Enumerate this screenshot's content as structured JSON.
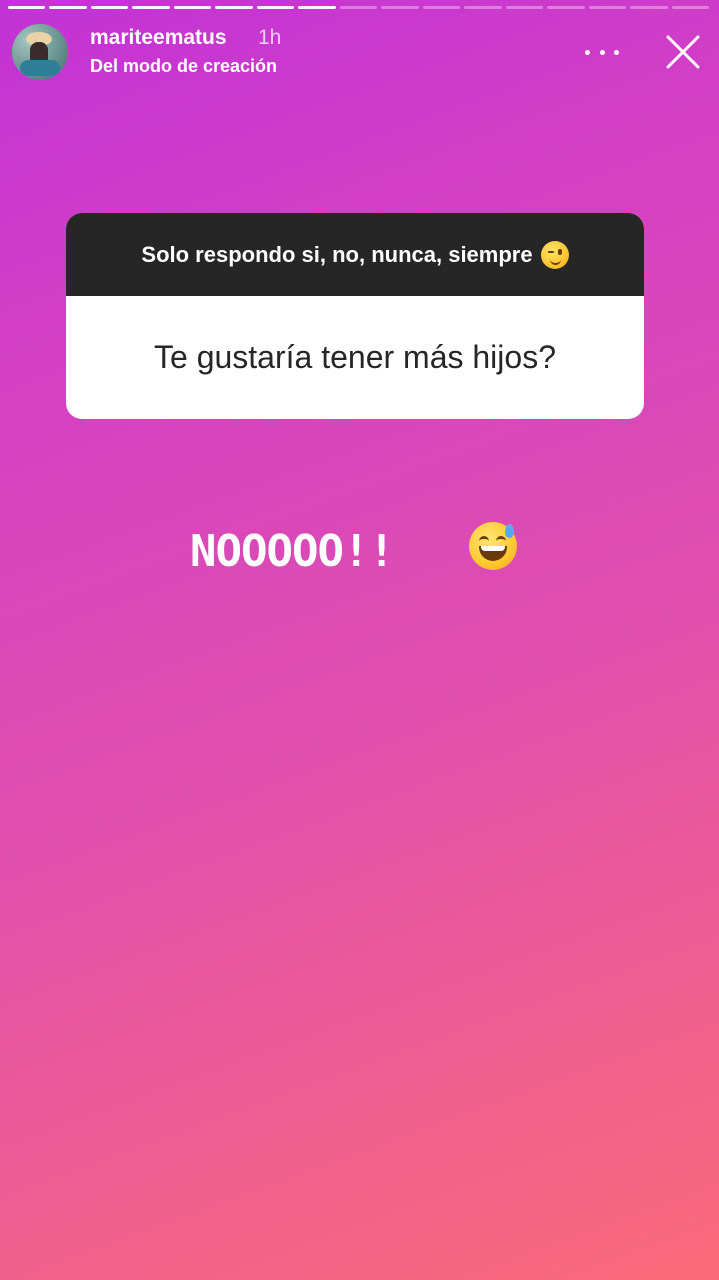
{
  "story": {
    "segments": 17,
    "progress_fraction": 0.45
  },
  "header": {
    "username": "mariteematus",
    "time": "1h",
    "subtitle": "Del modo de creación"
  },
  "question_sticker": {
    "prompt": "Solo respondo si, no, nunca, siempre",
    "question": "Te gustaría tener más hijos?"
  },
  "answer": {
    "text": "NOOOOO!!"
  },
  "colors": {
    "gradient_start": "#c232d6",
    "gradient_end": "#fb6a78",
    "sticker_header": "#262626"
  },
  "icons": [
    "more-icon",
    "close-icon",
    "wink-emoji",
    "grinning-sweat-emoji"
  ]
}
